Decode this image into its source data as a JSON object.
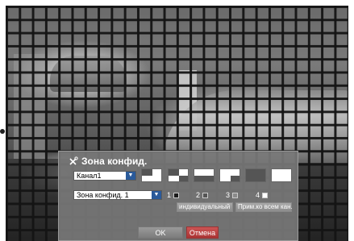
{
  "dialog": {
    "title": "Зона конфид.",
    "title_icon": "tools-icon",
    "channel_select": {
      "value": "Канал1"
    },
    "zone_select": {
      "value": "Зона конфид. 1"
    },
    "zones": [
      {
        "label": "1",
        "color": "#1a1a1a"
      },
      {
        "label": "2",
        "color": "#555555"
      },
      {
        "label": "3",
        "color": "#8a8a8a"
      },
      {
        "label": "4",
        "color": "#ffffff"
      }
    ],
    "individual_label": "индивидуальный",
    "apply_all_label": "Прим.ко всем кан.",
    "ok_label": "OK",
    "cancel_label": "Отмена"
  },
  "colors": {
    "dialog_bg": "#787878",
    "select_arrow": "#2a5a9a",
    "cancel_btn": "#b03a3a"
  }
}
